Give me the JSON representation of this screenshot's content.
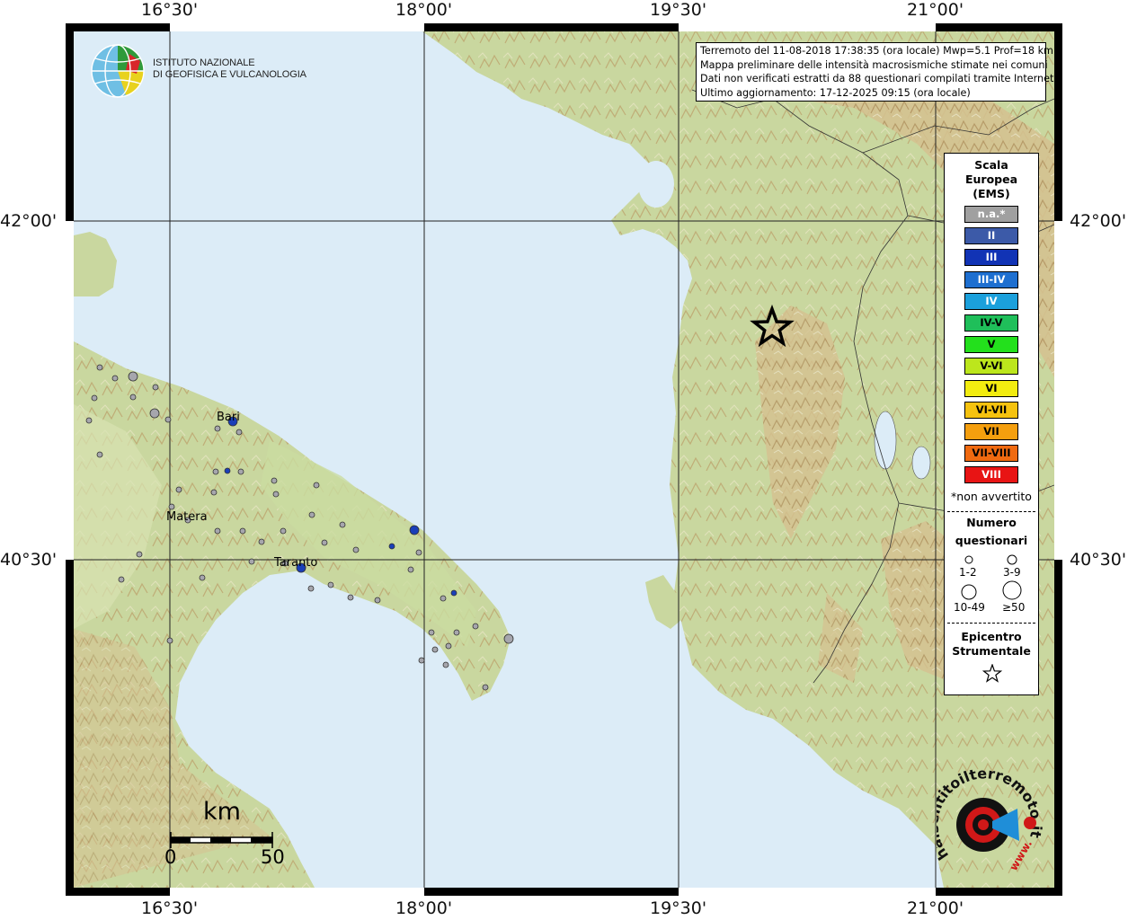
{
  "coordinates": {
    "longitudes": [
      "16°30'",
      "18°00'",
      "19°30'",
      "21°00'"
    ],
    "latitudes": [
      "42°00'",
      "40°30'"
    ]
  },
  "info_box": {
    "line1": "Terremoto del 11-08-2018 17:38:35 (ora locale) Mwp=5.1 Prof=18 km",
    "line2": "Mappa preliminare delle intensità macrosismiche stimate nei comuni",
    "line3": "Dati non verificati estratti da 88 questionari compilati tramite Internet.",
    "line4": "Ultimo aggiornamento: 17-12-2025 09:15 (ora locale)"
  },
  "ingv": {
    "line1": "ISTITUTO NAZIONALE",
    "line2": "DI GEOFISICA E VULCANOLOGIA"
  },
  "legend": {
    "title1": "Scala",
    "title2": "Europea",
    "title3": "(EMS)",
    "ems_levels": [
      {
        "label": "n.a.*",
        "color": "#a0a0a0",
        "text_color": "#ffffff"
      },
      {
        "label": "II",
        "color": "#3c5aa8",
        "text_color": "#ffffff"
      },
      {
        "label": "III",
        "color": "#1133b5",
        "text_color": "#ffffff"
      },
      {
        "label": "III-IV",
        "color": "#1e6fd0",
        "text_color": "#ffffff"
      },
      {
        "label": "IV",
        "color": "#1ba0dc",
        "text_color": "#ffffff"
      },
      {
        "label": "IV-V",
        "color": "#1fbf5a",
        "text_color": "#000000"
      },
      {
        "label": "V",
        "color": "#23e01c",
        "text_color": "#000000"
      },
      {
        "label": "V-VI",
        "color": "#bce61c",
        "text_color": "#000000"
      },
      {
        "label": "VI",
        "color": "#f2ec10",
        "text_color": "#000000"
      },
      {
        "label": "VI-VII",
        "color": "#f5c20f",
        "text_color": "#000000"
      },
      {
        "label": "VII",
        "color": "#f59f0e",
        "text_color": "#000000"
      },
      {
        "label": "VII-VIII",
        "color": "#f06a10",
        "text_color": "#000000"
      },
      {
        "label": "VIII",
        "color": "#e81414",
        "text_color": "#ffffff"
      }
    ],
    "not_felt_note": "*non avvertito",
    "count_title1": "Numero",
    "count_title2": "questionari",
    "sizes": [
      "1-2",
      "3-9",
      "10-49",
      "≥50"
    ],
    "epicenter1": "Epicentro",
    "epicenter2": "Strumentale",
    "epicenter_icon": "star-icon"
  },
  "cities": [
    "Bari",
    "Matera",
    "Taranto"
  ],
  "scalebar": {
    "unit": "km",
    "start": "0",
    "end": "50"
  },
  "logo_hst": {
    "text": "haisentitoilterremoto.it",
    "www": "www."
  }
}
